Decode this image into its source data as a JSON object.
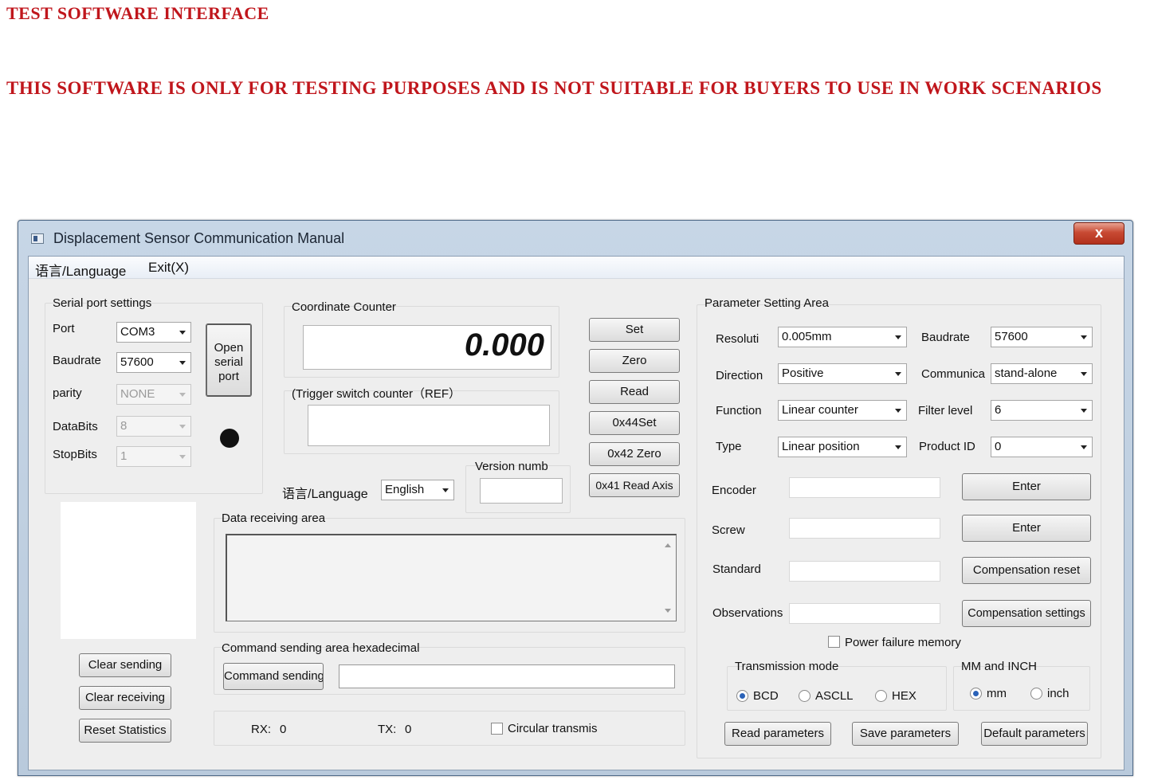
{
  "banner": {
    "line1": "TEST SOFTWARE INTERFACE",
    "line2": "THIS SOFTWARE IS ONLY FOR TESTING PURPOSES AND IS NOT SUITABLE FOR BUYERS TO USE IN WORK SCENARIOS"
  },
  "window": {
    "title": "Displacement Sensor Communication Manual",
    "close_label": "x",
    "icon": "app-window-icon"
  },
  "menu": {
    "language": "语言/Language",
    "exit": "Exit(X)"
  },
  "serial": {
    "group_title": "Serial port settings",
    "port_label": "Port",
    "port_value": "COM3",
    "baud_label": "Baudrate",
    "baud_value": "57600",
    "parity_label": "parity",
    "parity_value": "NONE",
    "databits_label": "DataBits",
    "databits_value": "8",
    "stopbits_label": "StopBits",
    "stopbits_value": "1",
    "open_line1": "Open",
    "open_line2": "serial",
    "open_line3": "port",
    "status_color": "#111111"
  },
  "counter": {
    "title": "Coordinate Counter",
    "value": "0.000",
    "trigger_title": "(Trigger switch counter（REF）"
  },
  "commands": {
    "set": "Set",
    "zero": "Zero",
    "read": "Read",
    "set44": "0x44Set",
    "zero42": "0x42 Zero",
    "read41": "0x41 Read Axis"
  },
  "language": {
    "label": "语言/Language",
    "value": "English"
  },
  "version": {
    "label": "Version numb"
  },
  "receive": {
    "title": "Data receiving area"
  },
  "send": {
    "title": "Command sending area hexadecimal",
    "button": "Command sending"
  },
  "left_buttons": {
    "clear_sending": "Clear sending",
    "clear_receiving": "Clear receiving",
    "reset_stats": "Reset Statistics"
  },
  "stats": {
    "rx_label": "RX:",
    "rx_value": "0",
    "tx_label": "TX:",
    "tx_value": "0",
    "circular": "Circular transmis"
  },
  "params": {
    "title": "Parameter Setting Area",
    "resolution_label": "Resoluti",
    "resolution_value": "0.005mm",
    "baud_label": "Baudrate",
    "baud_value": "57600",
    "direction_label": "Direction",
    "direction_value": "Positive",
    "comm_label": "Communica",
    "comm_value": "stand-alone",
    "function_label": "Function",
    "function_value": "Linear counter",
    "filter_label": "Filter level",
    "filter_value": "6",
    "type_label": "Type",
    "type_value": "Linear position",
    "product_label": "Product ID",
    "product_value": "0",
    "encoder_label": "Encoder",
    "screw_label": "Screw",
    "standard_label": "Standard",
    "observations_label": "Observations",
    "enter1": "Enter",
    "enter2": "Enter",
    "comp_reset": "Compensation reset",
    "comp_settings": "Compensation settings",
    "power_memory": "Power failure memory"
  },
  "transmission": {
    "title": "Transmission mode",
    "bcd": "BCD",
    "ascll": "ASCLL",
    "hex": "HEX"
  },
  "units": {
    "title": "MM and INCH",
    "mm": "mm",
    "inch": "inch"
  },
  "param_buttons": {
    "read": "Read parameters",
    "save": "Save parameters",
    "default": "Default parameters"
  }
}
